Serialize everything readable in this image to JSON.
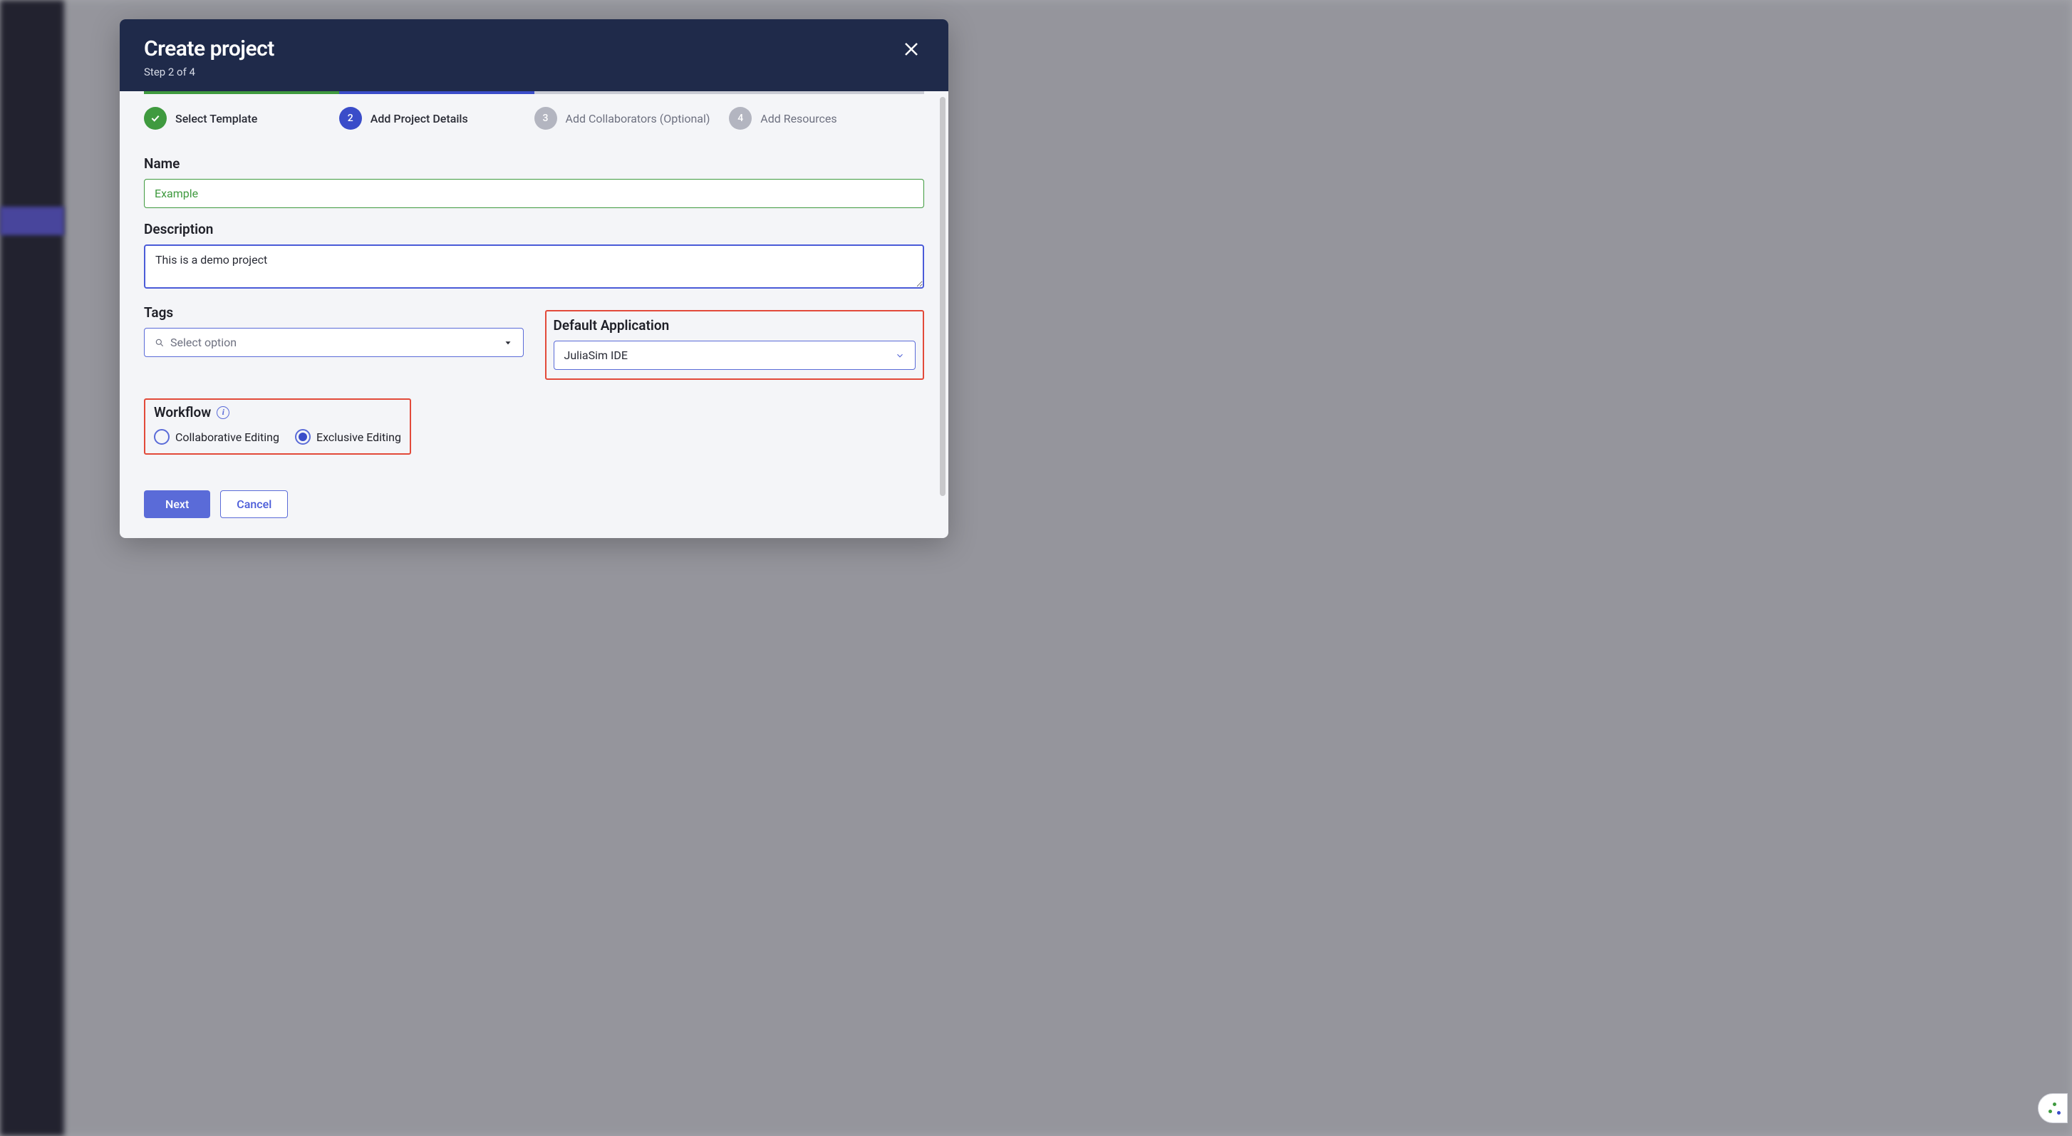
{
  "modal": {
    "title": "Create project",
    "step_text": "Step 2 of 4"
  },
  "stepper": {
    "steps": [
      {
        "num": "✓",
        "label": "Select Template"
      },
      {
        "num": "2",
        "label": "Add Project Details"
      },
      {
        "num": "3",
        "label": "Add Collaborators (Optional)"
      },
      {
        "num": "4",
        "label": "Add Resources"
      }
    ]
  },
  "form": {
    "name_label": "Name",
    "name_value": "Example",
    "description_label": "Description",
    "description_value": "This is a demo project",
    "tags_label": "Tags",
    "tags_placeholder": "Select option",
    "default_app_label": "Default Application",
    "default_app_value": "JuliaSim IDE",
    "workflow_label": "Workflow",
    "workflow_options": {
      "collab": "Collaborative Editing",
      "exclusive": "Exclusive Editing"
    }
  },
  "buttons": {
    "next": "Next",
    "cancel": "Cancel"
  }
}
